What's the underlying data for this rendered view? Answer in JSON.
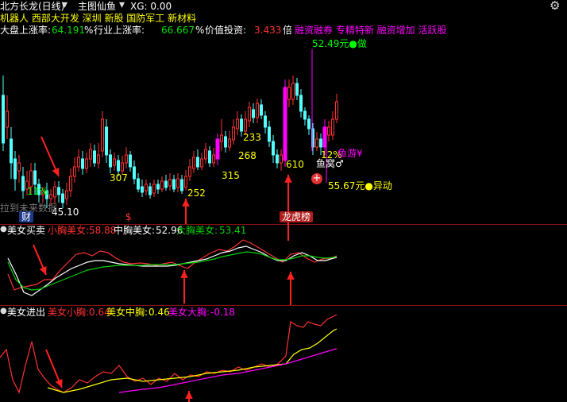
{
  "header": {
    "title": "北方长龙(日线)",
    "main_indicator": "主图仙鱼",
    "xg": "XG: 0.00",
    "tags_yellow": "机器人 西部大开发 深圳 新股 国防军工 新材料",
    "tags_magenta": "融资融券 专精特新 融资增加 活跃股",
    "market_up_label": "大盘上涨率:",
    "market_up_value": "64.191",
    "industry_up_label": "行业上涨率:",
    "industry_up_value": "66.667",
    "pct": "%",
    "value_invest_label": "价值投资:",
    "value_invest_value": "3.433",
    "times_label": "倍"
  },
  "main_chart": {
    "labels": {
      "price_top": "52.49元●做",
      "pct12": "12%",
      "fish_swim": "鱼游¥",
      "fish_nest": "鱼窝♂",
      "price_move": "55.67元●异动",
      "low_4510": "45.10",
      "n307": "307",
      "n252": "252",
      "n315": "315",
      "n268": "268",
      "n233": "233",
      "n610": "610",
      "n11": "11%",
      "future_data": "拉到未来数据",
      "cai": "财",
      "dollar": "$",
      "longhu": "龙虎榜"
    },
    "colors": {
      "up": "#ff3232",
      "down": "#54ffff",
      "strong": "#ff00ff",
      "price_label": "#ffff00"
    }
  },
  "panel1": {
    "name": "美女买卖",
    "small_label": "小胸美女:",
    "small_value": "58.88",
    "mid_label": "中胸美女:",
    "mid_value": "52.96",
    "big_label": "大胸美女:",
    "big_value": "53.41",
    "colors": {
      "small": "#ff3232",
      "mid": "#ffffff",
      "big": "#00d000"
    }
  },
  "panel2": {
    "name": "美女进出",
    "small_label": "美女小胸:",
    "small_value": "0.64",
    "mid_label": "美女中胸:",
    "mid_value": "0.46",
    "big_label": "美女大胸:",
    "big_value": "-0.18",
    "colors": {
      "small": "#ff3232",
      "mid": "#ffff00",
      "big": "#ff00ff"
    }
  }
}
